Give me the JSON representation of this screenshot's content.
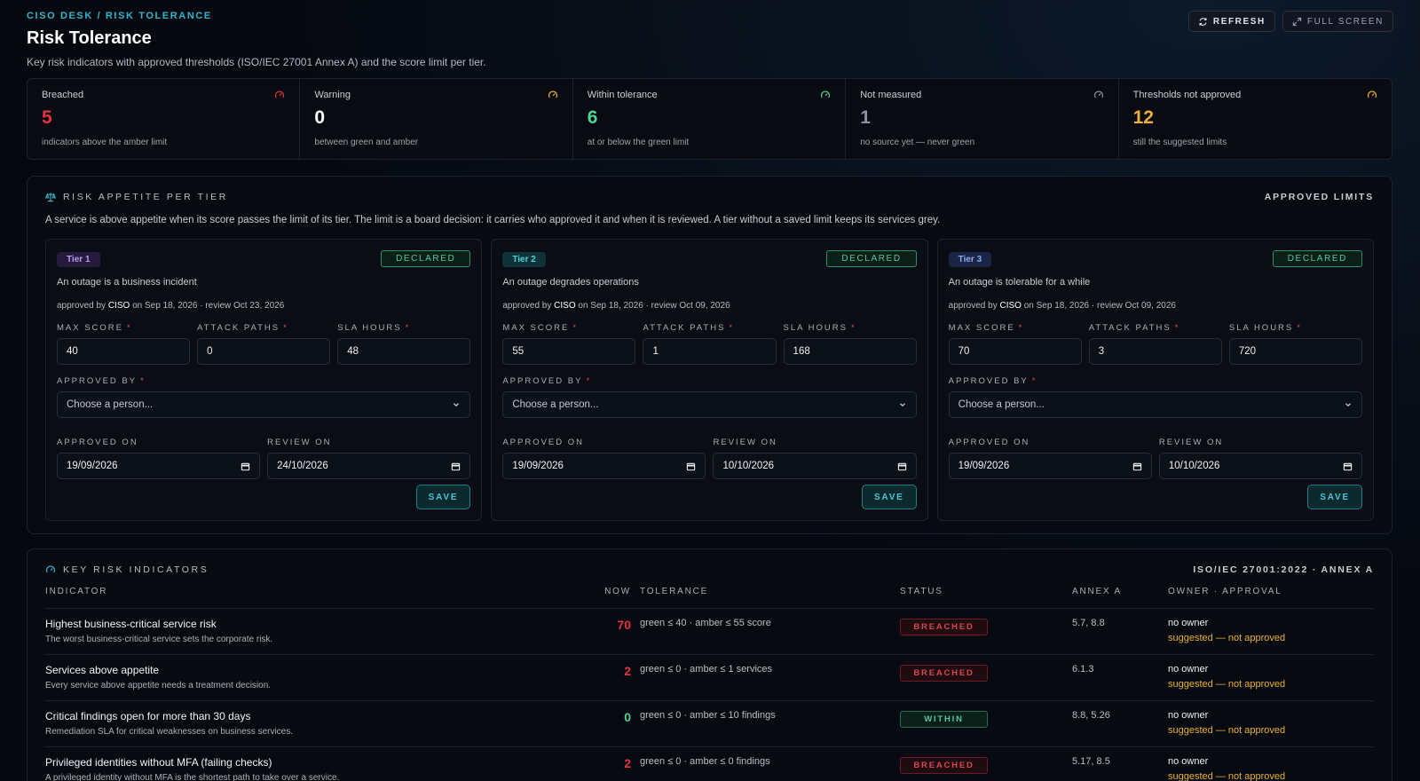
{
  "header": {
    "breadcrumb": "CISO DESK / RISK TOLERANCE",
    "title": "Risk Tolerance",
    "subtitle": "Key risk indicators with approved thresholds (ISO/IEC 27001 Annex A) and the score limit per tier.",
    "refresh_label": "REFRESH",
    "fullscreen_label": "FULL SCREEN"
  },
  "stats": [
    {
      "label": "Breached",
      "value": "5",
      "desc": "indicators above the amber limit",
      "color": "#e0343f"
    },
    {
      "label": "Warning",
      "value": "0",
      "desc": "between green and amber",
      "color": "#ffffff"
    },
    {
      "label": "Within tolerance",
      "value": "6",
      "desc": "at or below the green limit",
      "color": "#4fd394"
    },
    {
      "label": "Not measured",
      "value": "1",
      "desc": "no source yet — never green",
      "color": "#8a93a3"
    },
    {
      "label": "Thresholds not approved",
      "value": "12",
      "desc": "still the suggested limits",
      "color": "#f0b03a"
    }
  ],
  "appetite": {
    "title": "RISK APPETITE PER TIER",
    "right_label": "APPROVED LIMITS",
    "description": "A service is above appetite when its score passes the limit of its tier. The limit is a board decision: it carries who approved it and when it is reviewed. A tier without a saved limit keeps its services grey.",
    "labels": {
      "max_score": "MAX SCORE",
      "attack_paths": "ATTACK PATHS",
      "sla_hours": "SLA HOURS",
      "approved_by": "APPROVED BY",
      "approved_on": "APPROVED ON",
      "review_on": "REVIEW ON",
      "required": "*",
      "save": "SAVE",
      "declared": "DECLARED",
      "approved_by_prefix": "approved by",
      "on_word": "on"
    },
    "tiers": [
      {
        "badge": "Tier 1",
        "desc": "An outage is a business incident",
        "approver": "CISO",
        "approved_meta": "Sep 18, 2026 · review Oct 23, 2026",
        "max_score": "40",
        "attack_paths": "0",
        "sla_hours": "48",
        "approved_by_placeholder": "Choose a person...",
        "approved_on": "19/09/2026",
        "review_on": "24/10/2026"
      },
      {
        "badge": "Tier 2",
        "desc": "An outage degrades operations",
        "approver": "CISO",
        "approved_meta": "Sep 18, 2026 · review Oct 09, 2026",
        "max_score": "55",
        "attack_paths": "1",
        "sla_hours": "168",
        "approved_by_placeholder": "Choose a person...",
        "approved_on": "19/09/2026",
        "review_on": "10/10/2026"
      },
      {
        "badge": "Tier 3",
        "desc": "An outage is tolerable for a while",
        "approver": "CISO",
        "approved_meta": "Sep 18, 2026 · review Oct 09, 2026",
        "max_score": "70",
        "attack_paths": "3",
        "sla_hours": "720",
        "approved_by_placeholder": "Choose a person...",
        "approved_on": "19/09/2026",
        "review_on": "10/10/2026"
      }
    ]
  },
  "kri": {
    "title": "KEY RISK INDICATORS",
    "right_label": "ISO/IEC 27001:2022 · ANNEX A",
    "columns": [
      "INDICATOR",
      "NOW",
      "TOLERANCE",
      "STATUS",
      "ANNEX A",
      "OWNER · APPROVAL"
    ],
    "rows": [
      {
        "name": "Highest business-critical service risk",
        "sub": "The worst business-critical service sets the corporate risk.",
        "now": "70",
        "now_color": "#e0343f",
        "tolerance": "green ≤ 40 · amber ≤ 55 score",
        "status": "BREACHED",
        "annex": "5.7, 8.8",
        "owner": "no owner",
        "approval": "suggested — not approved"
      },
      {
        "name": "Services above appetite",
        "sub": "Every service above appetite needs a treatment decision.",
        "now": "2",
        "now_color": "#e0343f",
        "tolerance": "green ≤ 0 · amber ≤ 1 services",
        "status": "BREACHED",
        "annex": "6.1.3",
        "owner": "no owner",
        "approval": "suggested — not approved"
      },
      {
        "name": "Critical findings open for more than 30 days",
        "sub": "Remediation SLA for critical weaknesses on business services.",
        "now": "0",
        "now_color": "#4fd394",
        "tolerance": "green ≤ 0 · amber ≤ 10 findings",
        "status": "WITHIN",
        "annex": "8.8, 5.26",
        "owner": "no owner",
        "approval": "suggested — not approved"
      },
      {
        "name": "Privileged identities without MFA (failing checks)",
        "sub": "A privileged identity without MFA is the shortest path to take over a service.",
        "now": "2",
        "now_color": "#e0343f",
        "tolerance": "green ≤ 0 · amber ≤ 0 findings",
        "status": "BREACHED",
        "annex": "5.17, 8.5",
        "owner": "no owner",
        "approval": "suggested — not approved"
      }
    ]
  }
}
